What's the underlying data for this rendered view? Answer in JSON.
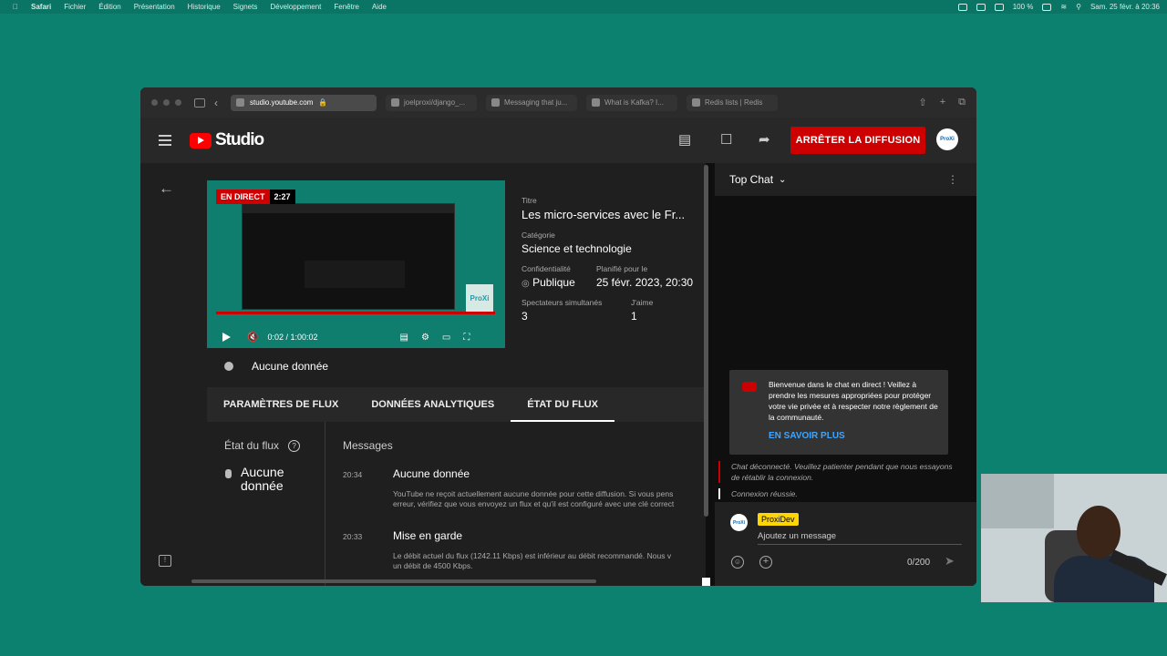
{
  "menubar": {
    "items": [
      "Safari",
      "Fichier",
      "Édition",
      "Présentation",
      "Historique",
      "Signets",
      "Développement",
      "Fenêtre",
      "Aide"
    ],
    "battery": "100 %",
    "datetime": "Sam. 25 févr. à 20:36"
  },
  "browser": {
    "url": "studio.youtube.com",
    "tabs": [
      "joelproxi/django_...",
      "Messaging that ju...",
      "What is Kafka? I...",
      "Redis lists | Redis"
    ]
  },
  "header": {
    "logo_text": "Studio",
    "stop_button": "ARRÊTER LA DIFFUSION",
    "avatar_text": "ProXi"
  },
  "player": {
    "live_badge": "EN DIRECT",
    "live_time": "2:27",
    "time": "0:02 / 1:00:02",
    "thumb_logo": "ProXi"
  },
  "stream_health": {
    "label": "Aucune donnée"
  },
  "details": {
    "title_label": "Titre",
    "title_value": "Les micro-services avec le Fr...",
    "category_label": "Catégorie",
    "category_value": "Science et technologie",
    "privacy_label": "Confidentialité",
    "privacy_value": "Publique",
    "scheduled_label": "Planifié pour le",
    "scheduled_value": "25 févr. 2023, 20:30",
    "viewers_label": "Spectateurs simultanés",
    "viewers_value": "3",
    "likes_label": "J'aime",
    "likes_value": "1"
  },
  "tabs": [
    "PARAMÈTRES DE FLUX",
    "DONNÉES ANALYTIQUES",
    "ÉTAT DU FLUX"
  ],
  "stream_status": {
    "title": "État du flux",
    "value": "Aucune donnée"
  },
  "messages": {
    "title": "Messages",
    "items": [
      {
        "time": "20:34",
        "head": "Aucune donnée",
        "line1": "YouTube ne reçoit actuellement aucune donnée pour cette diffusion. Si vous pens",
        "line2": "erreur, vérifiez que vous envoyez un flux et qu'il est configuré avec une clé correct"
      },
      {
        "time": "20:33",
        "head": "Mise en garde",
        "line1": "Le débit actuel du flux (1242.11 Kbps) est inférieur au débit recommandé. Nous v",
        "line2": "un débit de 4500 Kbps."
      }
    ]
  },
  "chat": {
    "header": "Top Chat",
    "welcome": "Bienvenue dans le chat en direct ! Veillez à prendre les mesures appropriées pour protéger votre vie privée et à respecter notre règlement de la communauté.",
    "learn_more": "EN SAVOIR PLUS",
    "sys1": "Chat déconnecté. Veuillez patienter pendant que nous essayons de rétablir la connexion.",
    "sys2": "Connexion réussie.",
    "username": "ProxiDev",
    "input_placeholder": "Ajoutez un message",
    "counter": "0/200"
  }
}
